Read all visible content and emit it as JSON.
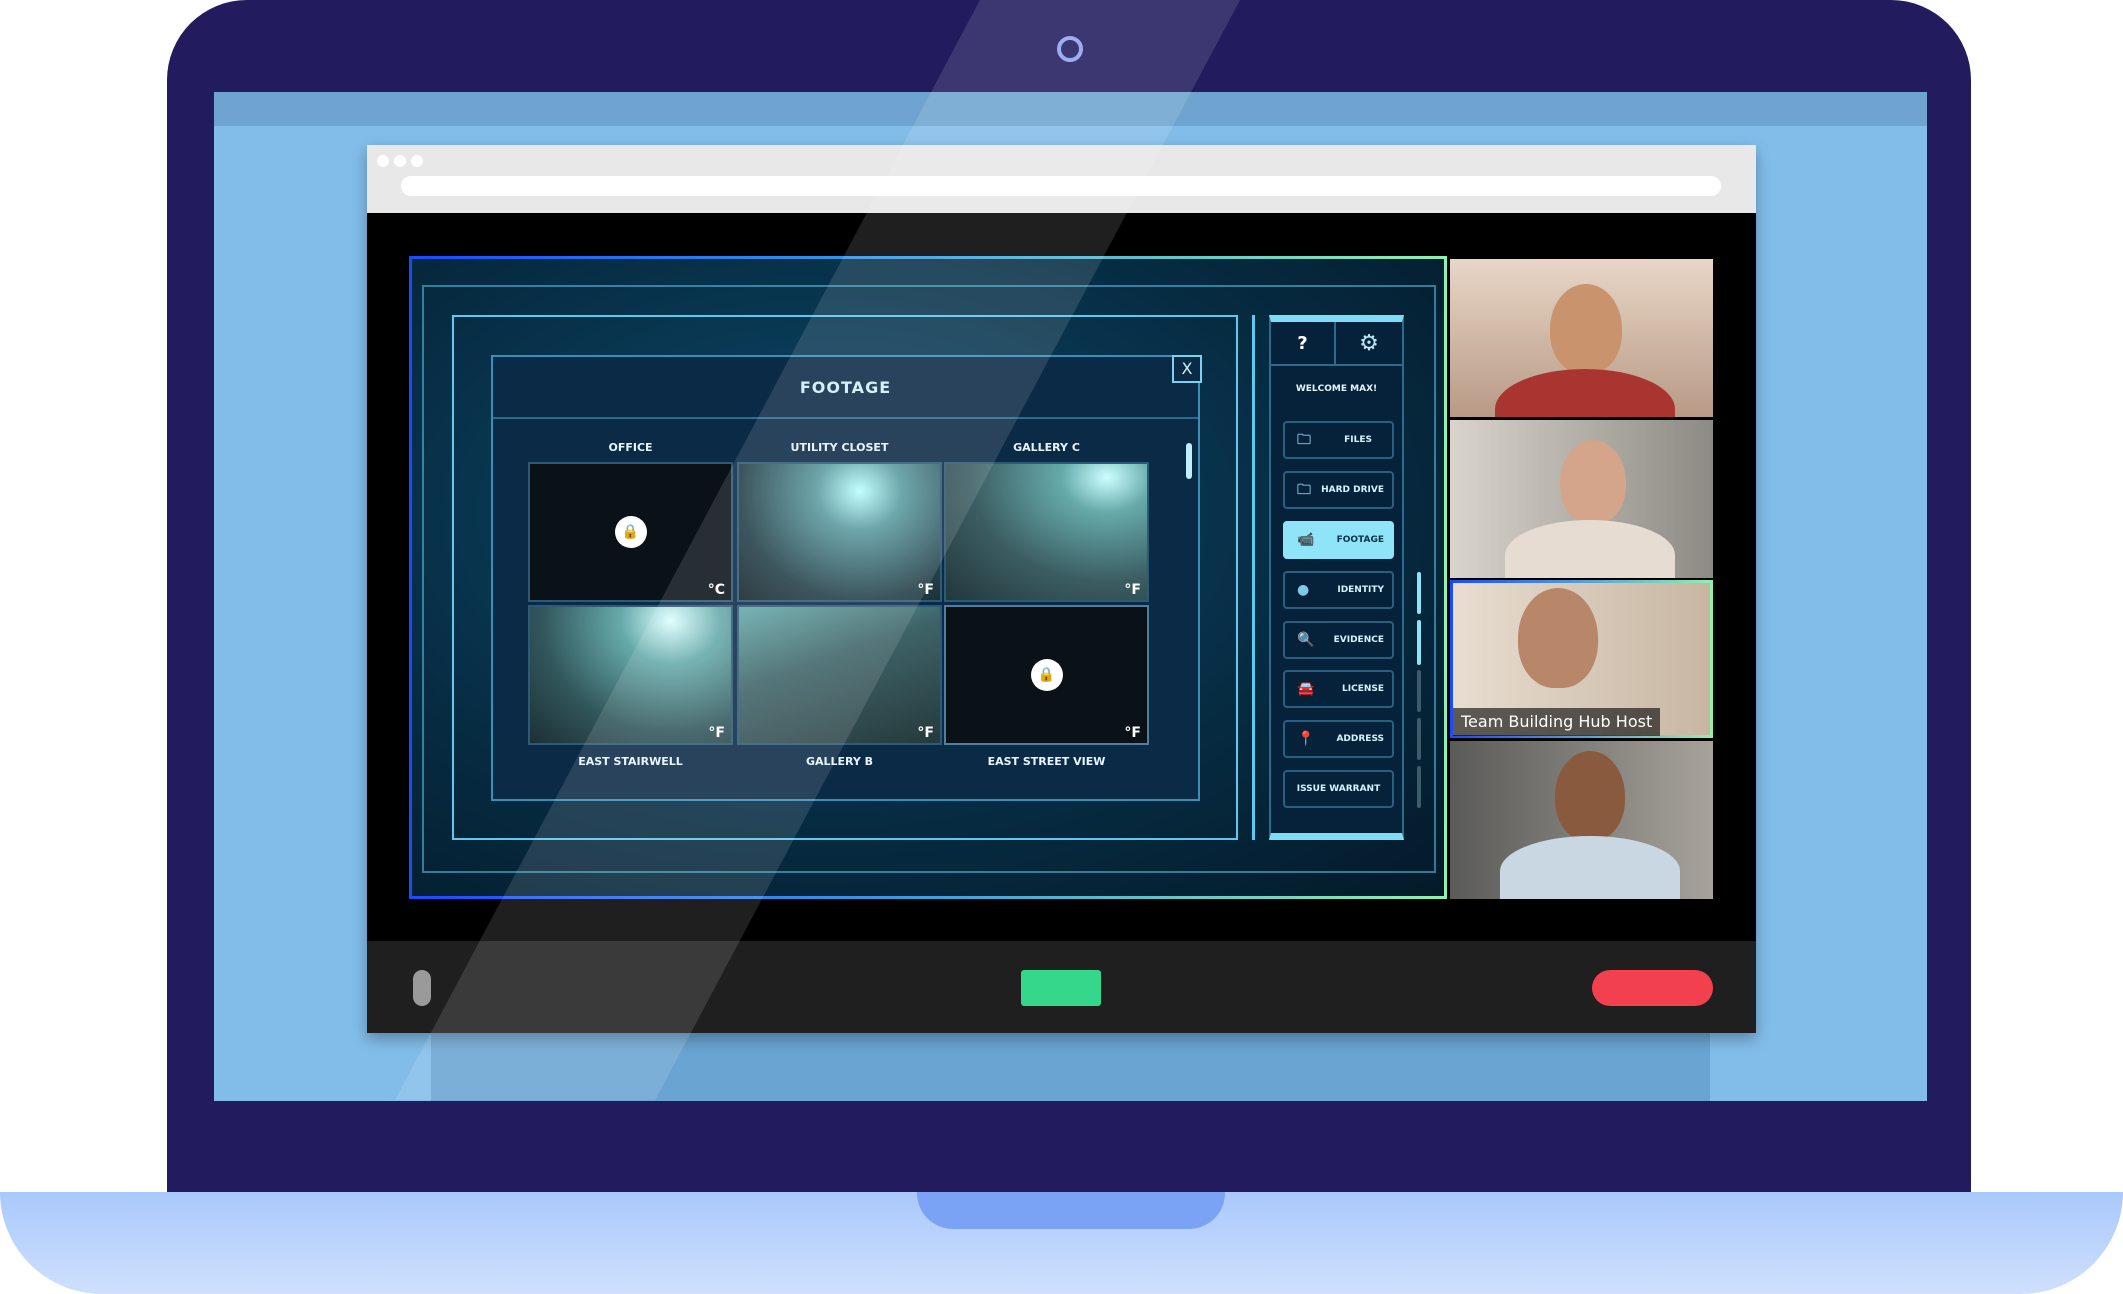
{
  "modal": {
    "title": "FOOTAGE",
    "close_label": "X"
  },
  "cameras": [
    {
      "name": "OFFICE",
      "unit": "°C",
      "locked": true
    },
    {
      "name": "UTILITY CLOSET",
      "unit": "°F",
      "locked": false
    },
    {
      "name": "GALLERY C",
      "unit": "°F",
      "locked": false
    },
    {
      "name": "EAST STAIRWELL",
      "unit": "°F",
      "locked": false
    },
    {
      "name": "GALLERY B",
      "unit": "°F",
      "locked": false
    },
    {
      "name": "EAST STREET VIEW",
      "unit": "°F",
      "locked": true
    }
  ],
  "sidebar": {
    "help_label": "?",
    "welcome": "WELCOME MAX!",
    "items": [
      {
        "label": "FILES",
        "icon": "folder-icon"
      },
      {
        "label": "HARD DRIVE",
        "icon": "folder-icon"
      },
      {
        "label": "FOOTAGE",
        "icon": "security-camera-icon",
        "active": true
      },
      {
        "label": "IDENTITY",
        "icon": "fingerprint-icon"
      },
      {
        "label": "EVIDENCE",
        "icon": "evidence-icon"
      },
      {
        "label": "LICENSE",
        "icon": "car-icon"
      },
      {
        "label": "ADDRESS",
        "icon": "map-pin-icon"
      },
      {
        "label": "ISSUE WARRANT"
      }
    ]
  },
  "participants": {
    "host_label": "Team Building Hub Host"
  },
  "colors": {
    "accent": "#8fe5f7",
    "join": "#35d78a",
    "leave": "#f2404f",
    "laptop": "#221c5e"
  }
}
